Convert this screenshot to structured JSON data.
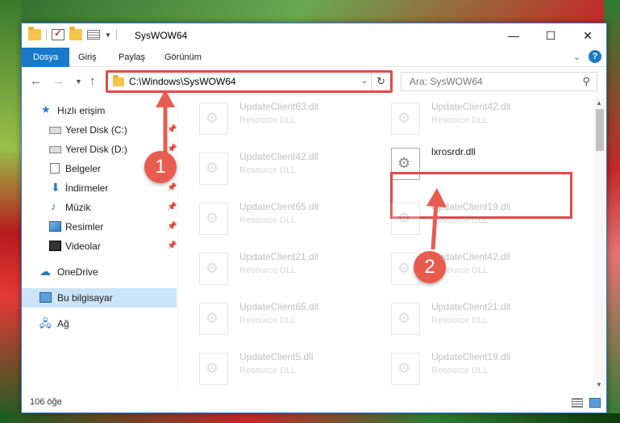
{
  "window": {
    "title": "SysWOW64",
    "controls": [
      "—",
      "☐",
      "✕"
    ]
  },
  "ribbon": {
    "tabs": [
      "Dosya",
      "Giriş",
      "Paylaş",
      "Görünüm"
    ],
    "help_label": "?"
  },
  "nav": {
    "address": "C:\\Windows\\SysWOW64",
    "search_placeholder": "Ara: SysWOW64"
  },
  "sidebar": {
    "quick_access": "Hızlı erişim",
    "items": [
      {
        "label": "Yerel Disk (C:)"
      },
      {
        "label": "Yerel Disk (D:)"
      },
      {
        "label": "Belgeler"
      },
      {
        "label": "İndirmeler"
      },
      {
        "label": "Müzik"
      },
      {
        "label": "Resimler"
      },
      {
        "label": "Videolar"
      }
    ],
    "onedrive": "OneDrive",
    "this_pc": "Bu bilgisayar",
    "network": "Ağ"
  },
  "files": {
    "type_label": "Resource DLL",
    "ghost_rows": [
      [
        "UpdateClient63.dll",
        "UpdateClient42.dll"
      ],
      [
        "UpdateClient42.dll",
        ""
      ],
      [
        "UpdateClient65.dll",
        "UpdateClient19.dll"
      ],
      [
        "UpdateClient21.dll",
        "UpdateClient42.dll"
      ],
      [
        "UpdateClient65.dll",
        "UpdateClient21.dll"
      ],
      [
        "UpdateClient5.dll",
        "UpdateClient19.dll"
      ]
    ],
    "highlighted": "lxrosrdr.dll"
  },
  "status": {
    "count": "106 öğe"
  },
  "annotations": {
    "step1": "1",
    "step2": "2",
    "color": "#e14a4a"
  }
}
